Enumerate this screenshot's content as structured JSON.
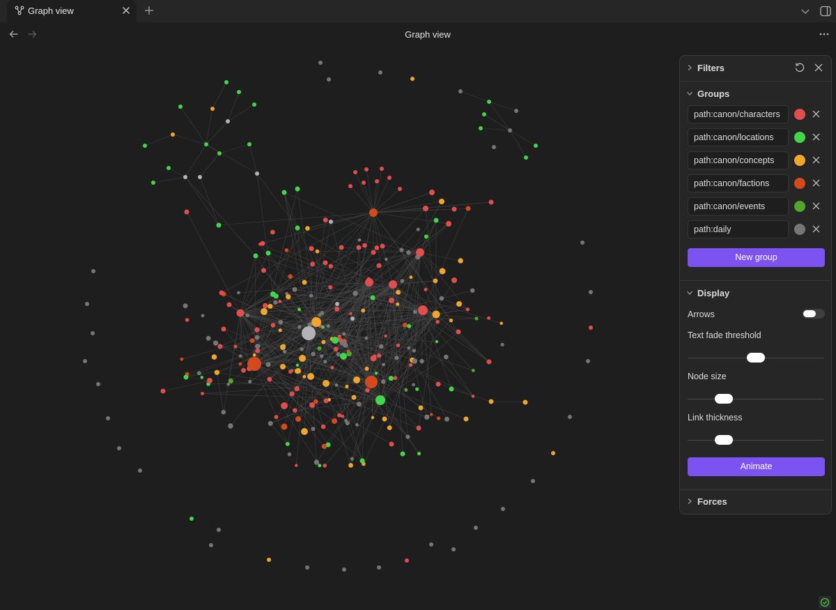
{
  "tab": {
    "title": "Graph view",
    "icon": "graph-icon"
  },
  "toolbar": {
    "title": "Graph view"
  },
  "panel": {
    "filters_label": "Filters",
    "groups_label": "Groups",
    "groups": [
      {
        "query": "path:canon/characters",
        "color": "#e04e4e"
      },
      {
        "query": "path:canon/locations",
        "color": "#43d64b"
      },
      {
        "query": "path:canon/concepts",
        "color": "#f0a62c"
      },
      {
        "query": "path:canon/factions",
        "color": "#d44a1c"
      },
      {
        "query": "path:canon/events",
        "color": "#52a62c"
      },
      {
        "query": "path:daily",
        "color": "#767676"
      }
    ],
    "new_group_label": "New group",
    "display_label": "Display",
    "arrows_label": "Arrows",
    "arrows_on": false,
    "text_fade_label": "Text fade threshold",
    "text_fade_value": 0.5,
    "node_size_label": "Node size",
    "node_size_value": 0.23,
    "link_thickness_label": "Link thickness",
    "link_thickness_value": 0.23,
    "animate_label": "Animate",
    "forces_label": "Forces"
  },
  "graph_colors": {
    "background": "#1e1e1e",
    "link": "#4a4a4a",
    "characters": "#e04e4e",
    "locations": "#43d64b",
    "concepts": "#f0a62c",
    "factions": "#d44a1c",
    "events": "#52a62c",
    "daily": "#767676",
    "other": "#b4b4b8"
  }
}
